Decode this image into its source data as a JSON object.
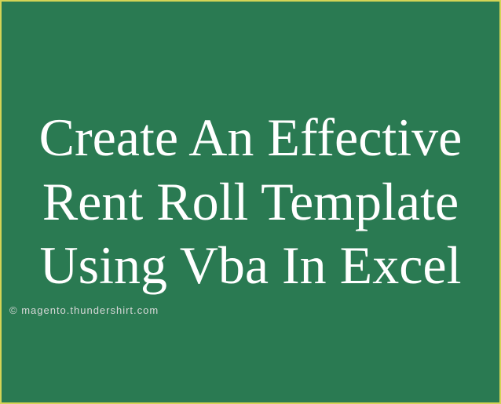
{
  "title": "Create An Effective Rent Roll Template Using Vba In Excel",
  "watermark": "© magento.thundershirt.com"
}
